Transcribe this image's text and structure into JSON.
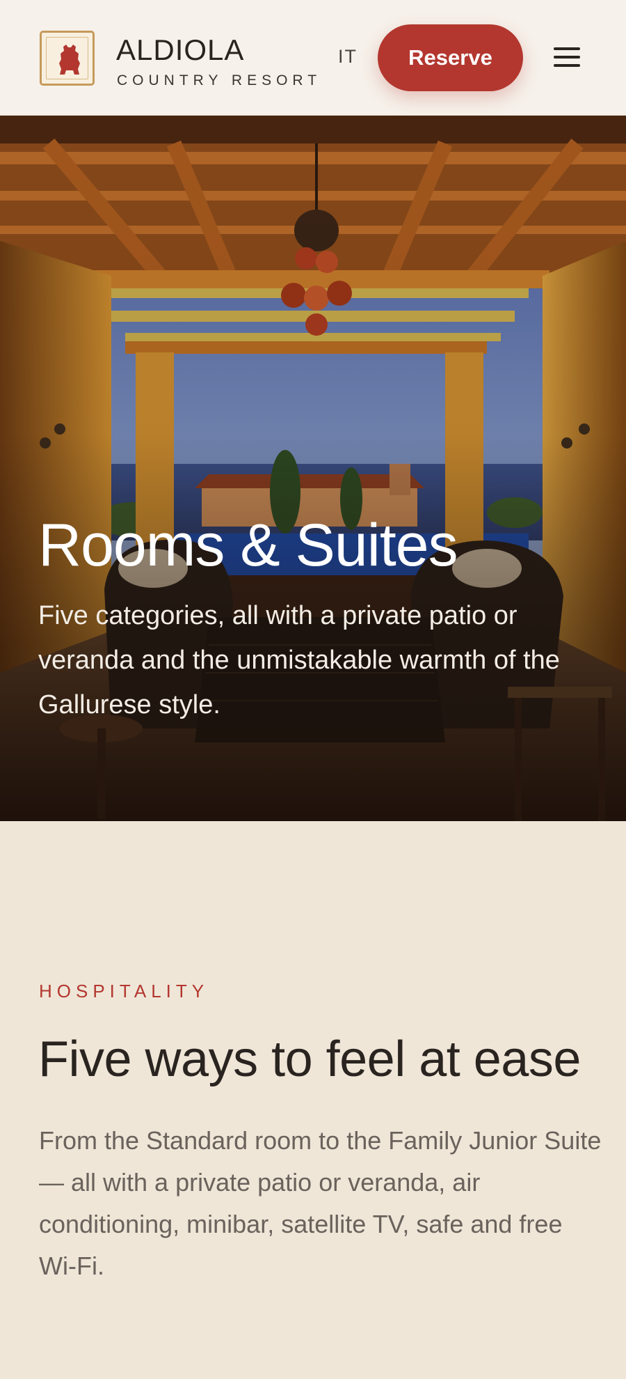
{
  "header": {
    "brand_name": "ALDIOLA",
    "brand_subtitle": "COUNTRY RESORT",
    "language": "IT",
    "reserve_label": "Reserve",
    "menu_icon": "hamburger-menu-icon",
    "logo_icon": "boar-emblem-icon"
  },
  "hero": {
    "title": "Rooms & Suites",
    "text": "Five categories, all with a private patio or veranda and the unmistakable warmth of the Gallurese style."
  },
  "intro": {
    "eyebrow": "HOSPITALITY",
    "title": "Five ways to feel at ease",
    "text": "From the Standard room to the Family Junior Suite — all with a private patio or veranda, air conditioning, minibar, satellite TV, safe and free Wi-Fi."
  },
  "colors": {
    "accent": "#b3372f",
    "background": "#efe6d8",
    "header_background": "#f6f1ea",
    "logo_gold": "#c59a5a"
  }
}
